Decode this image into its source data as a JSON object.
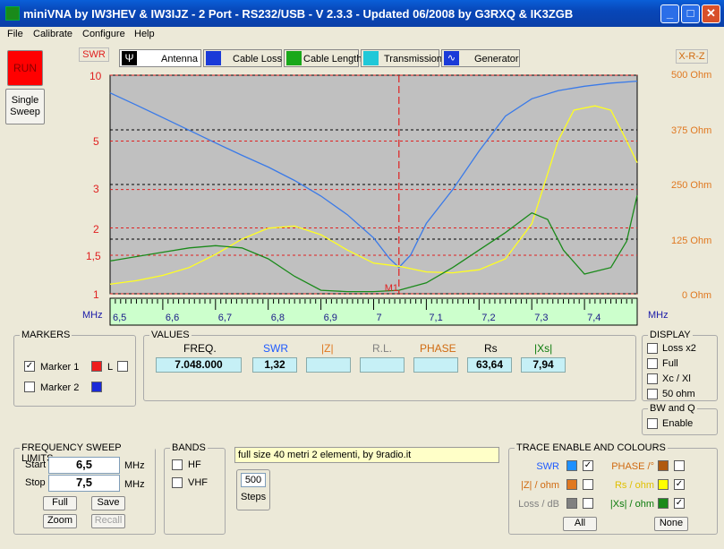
{
  "window": {
    "title": "miniVNA by IW3HEV & IW3IJZ - 2 Port - RS232/USB - V 2.3.3 - Updated 06/2008 by G3RXQ & IK3ZGB"
  },
  "menu": [
    "File",
    "Calibrate",
    "Configure",
    "Help"
  ],
  "side": {
    "run": "RUN",
    "single_sweep": "Single Sweep"
  },
  "modes": [
    "Antenna",
    "Cable Loss",
    "Cable Length",
    "Transmission",
    "Generator"
  ],
  "labels": {
    "swr": "SWR",
    "xrz": "X-R-Z",
    "mhz_left": "MHz",
    "mhz_right": "MHz",
    "marker": "M1"
  },
  "left_axis": [
    "10",
    "5",
    "3",
    "2",
    "1,5",
    "1"
  ],
  "right_axis": [
    "500 Ohm",
    "375 Ohm",
    "250 Ohm",
    "125 Ohm",
    "0 Ohm"
  ],
  "x_ticks": [
    "6,5",
    "6,6",
    "6,7",
    "6,8",
    "6,9",
    "7",
    "7,1",
    "7,2",
    "7,3",
    "7,4"
  ],
  "markers": {
    "title": "MARKERS",
    "m1": "Marker 1",
    "m1_l": "L",
    "m2": "Marker 2",
    "m1_checked": true,
    "m2_checked": false
  },
  "values": {
    "title": "VALUES",
    "headers": [
      "FREQ.",
      "SWR",
      "|Z|",
      "R.L.",
      "PHASE",
      "Rs",
      "|Xs|"
    ],
    "freq": "7.048.000",
    "swr": "1,32",
    "z": "",
    "rl": "",
    "phase": "",
    "rs": "63,64",
    "xs": "7,94"
  },
  "display": {
    "title": "DISPLAY",
    "options": [
      "Loss x2",
      "Full",
      "Xc / Xl",
      "50 ohm"
    ],
    "bwq_title": "BW and Q",
    "enable": "Enable"
  },
  "sweep": {
    "title": "FREQUENCY SWEEP LIMITS",
    "start_label": "Start",
    "start": "6,5",
    "stop_label": "Stop",
    "stop": "7,5",
    "unit": "MHz",
    "full": "Full",
    "save": "Save",
    "zoom": "Zoom",
    "recall": "Recall"
  },
  "bands": {
    "title": "BANDS",
    "hf": "HF",
    "vhf": "VHF"
  },
  "note": "full size 40 metri 2 elementi, by 9radio.it",
  "steps": {
    "value": "500",
    "label": "Steps"
  },
  "trace": {
    "title": "TRACE ENABLE AND COLOURS",
    "items": [
      {
        "name": "SWR",
        "color": "#1e90ff",
        "checked": true,
        "text": "#1e5aff"
      },
      {
        "name": "|Z| / ohm",
        "color": "#e07820",
        "checked": false,
        "text": "#d06a10"
      },
      {
        "name": "Loss / dB",
        "color": "#808080",
        "checked": false,
        "text": "#808080"
      },
      {
        "name": "PHASE /°",
        "color": "#b05a10",
        "checked": false,
        "text": "#d06a10"
      },
      {
        "name": "Rs / ohm",
        "color": "#ffff00",
        "checked": true,
        "text": "#e0c000"
      },
      {
        "name": "|Xs| / ohm",
        "color": "#1a8a1a",
        "checked": true,
        "text": "#0a7a0a"
      }
    ],
    "all": "All",
    "none": "None"
  },
  "chart_data": {
    "type": "line",
    "x_range": [
      6.5,
      7.5
    ],
    "y_left_scale": "log",
    "y_left_range": [
      1,
      10
    ],
    "y_right_range": [
      0,
      500
    ],
    "marker_x": 7.048,
    "series": [
      {
        "name": "SWR",
        "axis": "left",
        "color": "#3a7ae8",
        "x": [
          6.5,
          6.55,
          6.6,
          6.65,
          6.7,
          6.75,
          6.8,
          6.85,
          6.9,
          6.95,
          7.0,
          7.03,
          7.048,
          7.07,
          7.1,
          7.15,
          7.2,
          7.25,
          7.3,
          7.35,
          7.4,
          7.45,
          7.5
        ],
        "y": [
          8.3,
          7.3,
          6.4,
          5.6,
          4.9,
          4.3,
          3.8,
          3.3,
          2.8,
          2.3,
          1.8,
          1.45,
          1.32,
          1.5,
          2.1,
          3.0,
          4.5,
          6.5,
          7.8,
          8.5,
          8.9,
          9.2,
          9.4
        ]
      },
      {
        "name": "Rs / ohm",
        "axis": "right",
        "color": "#ffff20",
        "x": [
          6.5,
          6.55,
          6.6,
          6.65,
          6.7,
          6.75,
          6.8,
          6.85,
          6.9,
          6.95,
          7.0,
          7.048,
          7.1,
          7.15,
          7.2,
          7.25,
          7.3,
          7.35,
          7.38,
          7.42,
          7.45,
          7.48,
          7.5
        ],
        "y": [
          22,
          30,
          42,
          60,
          90,
          125,
          150,
          155,
          135,
          100,
          70,
          63,
          50,
          48,
          55,
          80,
          160,
          350,
          420,
          430,
          420,
          350,
          300
        ]
      },
      {
        "name": "|Xs| / ohm",
        "axis": "right",
        "color": "#1a8a1a",
        "x": [
          6.5,
          6.55,
          6.6,
          6.65,
          6.7,
          6.75,
          6.8,
          6.85,
          6.9,
          6.95,
          7.0,
          7.048,
          7.1,
          7.15,
          7.2,
          7.25,
          7.3,
          7.33,
          7.36,
          7.4,
          7.45,
          7.48,
          7.5
        ],
        "y": [
          75,
          85,
          95,
          105,
          110,
          105,
          80,
          40,
          8,
          5,
          5,
          8,
          25,
          60,
          100,
          140,
          185,
          170,
          100,
          45,
          60,
          120,
          225
        ]
      }
    ]
  }
}
